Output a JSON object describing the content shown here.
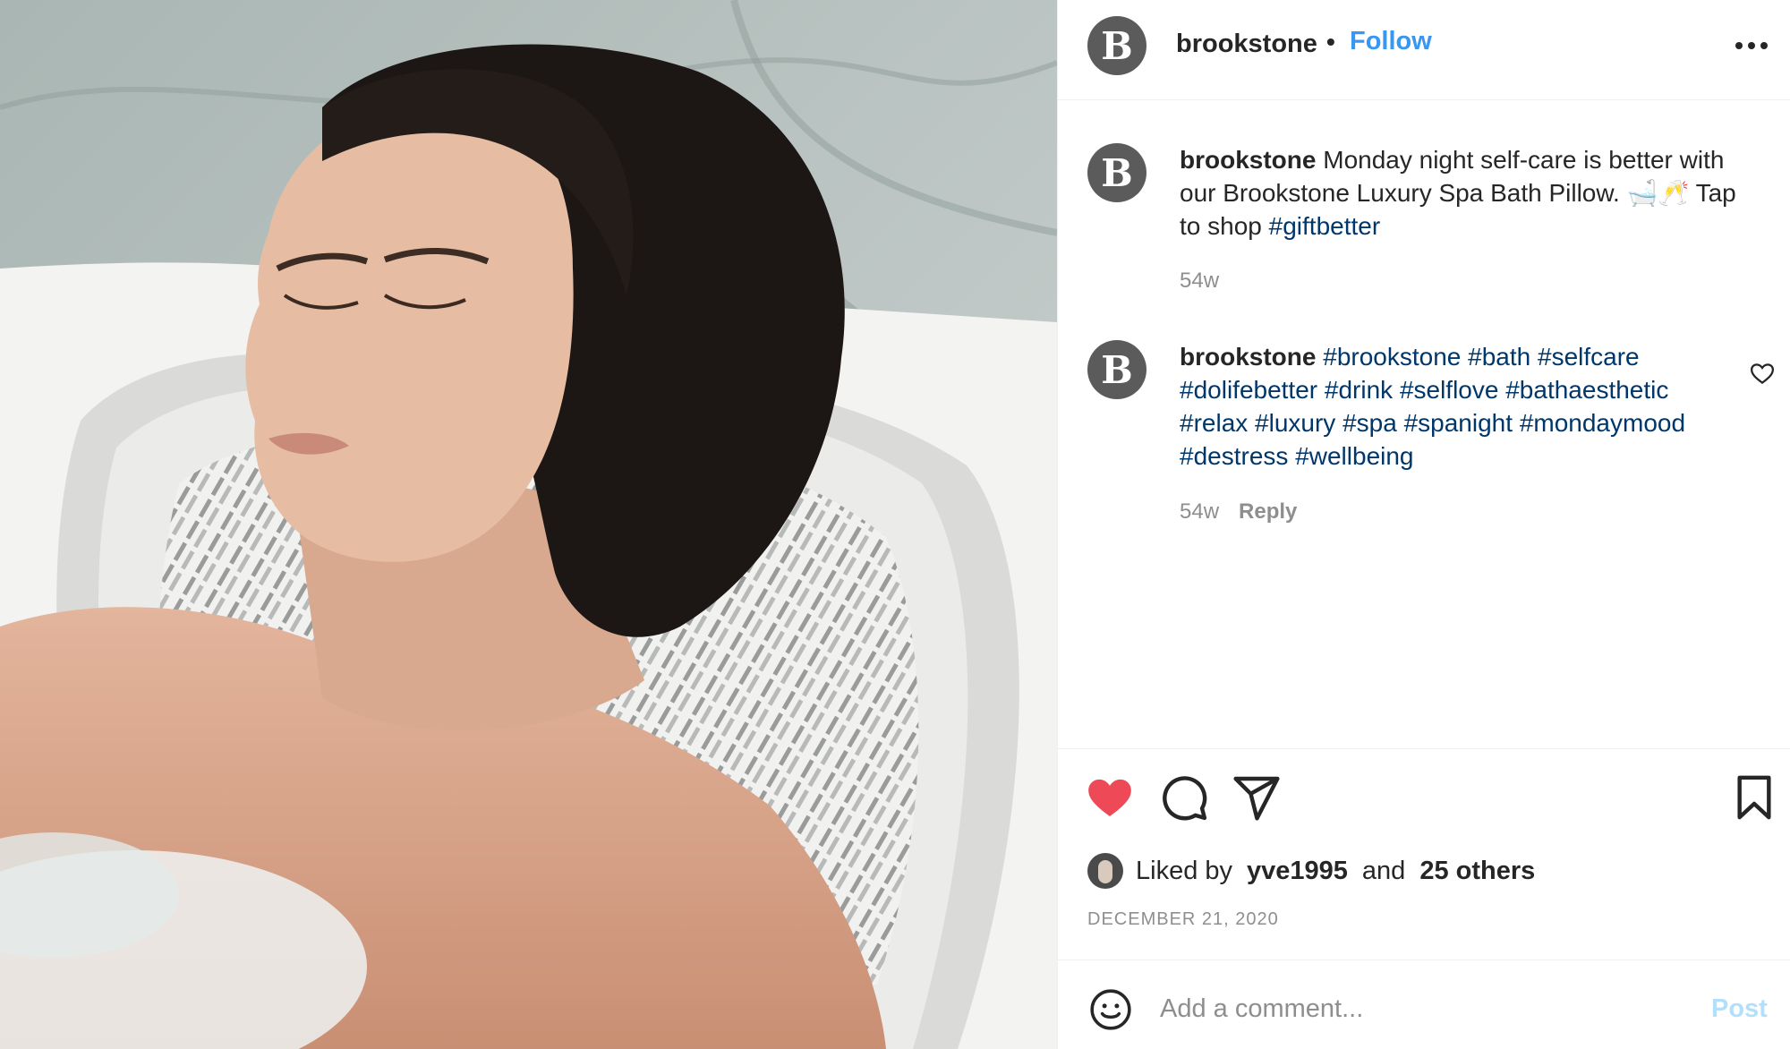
{
  "photo": {
    "alt": "image-of-woman-relaxing-on-bath-pillow"
  },
  "header": {
    "avatar_letter": "B",
    "username": "brookstone",
    "separator": "•",
    "follow_label": "Follow",
    "more_icon": "more-horizontal-icon"
  },
  "caption": {
    "avatar_letter": "B",
    "username": "brookstone",
    "text_before_tag": "Monday night self-care is better with our Brookstone Luxury Spa Bath Pillow. 🛁🥂 Tap to shop",
    "hashtag": "#giftbetter",
    "time": "54w"
  },
  "comment": {
    "avatar_letter": "B",
    "username": "brookstone",
    "hashtags": [
      "#brookstone",
      "#bath",
      "#selfcare",
      "#dolifebetter",
      "#drink",
      "#selflove",
      "#bathaesthetic",
      "#relax",
      "#luxury",
      "#spa",
      "#spanight",
      "#mondaymood",
      "#destress",
      "#wellbeing"
    ],
    "time": "54w",
    "reply_label": "Reply"
  },
  "actions": {
    "like_icon": "heart-filled-icon",
    "comment_icon": "comment-icon",
    "share_icon": "share-icon",
    "save_icon": "bookmark-icon",
    "like_color": "#ed4956"
  },
  "likes": {
    "prefix": "Liked by",
    "user": "yve1995",
    "joiner": "and",
    "others": "25 others"
  },
  "date": "DECEMBER 21, 2020",
  "add_comment": {
    "placeholder": "Add a comment...",
    "post_label": "Post",
    "emoji_icon": "smiley-icon"
  },
  "colors": {
    "link_blue": "#3897f0",
    "hashtag": "#00376b",
    "muted": "#8e8e8e",
    "post_disabled": "#b2dffc"
  }
}
